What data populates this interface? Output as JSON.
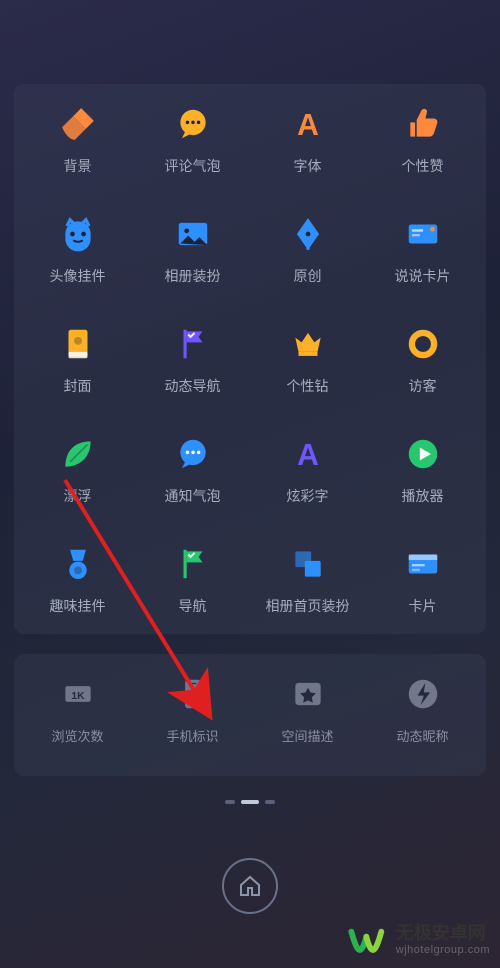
{
  "main": {
    "rows": [
      [
        {
          "name": "background",
          "label": "背景",
          "icon": "broom",
          "color": "#ff8a3d"
        },
        {
          "name": "comment-bubble",
          "label": "评论气泡",
          "icon": "chat",
          "color": "#ffb029"
        },
        {
          "name": "font",
          "label": "字体",
          "icon": "letterA",
          "color": "#ff8a3d"
        },
        {
          "name": "like",
          "label": "个性赞",
          "icon": "thumb",
          "color": "#ff8a3d"
        }
      ],
      [
        {
          "name": "avatar-pendant",
          "label": "头像挂件",
          "icon": "monster",
          "color": "#2e90ff"
        },
        {
          "name": "album-decor",
          "label": "相册装扮",
          "icon": "image",
          "color": "#2e90ff"
        },
        {
          "name": "original",
          "label": "原创",
          "icon": "pen",
          "color": "#2e90ff"
        },
        {
          "name": "talk-card",
          "label": "说说卡片",
          "icon": "card",
          "color": "#2e90ff"
        }
      ],
      [
        {
          "name": "cover",
          "label": "封面",
          "icon": "book",
          "color": "#ffb029"
        },
        {
          "name": "dynamic-nav",
          "label": "动态导航",
          "icon": "flag",
          "color": "#6f56ff"
        },
        {
          "name": "diamond",
          "label": "个性钻",
          "icon": "crown",
          "color": "#ffb029"
        },
        {
          "name": "visitor",
          "label": "访客",
          "icon": "circleO",
          "color": "#ffb029"
        }
      ],
      [
        {
          "name": "float",
          "label": "漂浮",
          "icon": "leaf",
          "color": "#28c76f"
        },
        {
          "name": "notify-bubble",
          "label": "通知气泡",
          "icon": "chatdots",
          "color": "#2e90ff"
        },
        {
          "name": "color-font",
          "label": "炫彩字",
          "icon": "letterA",
          "color": "#6f56ff"
        },
        {
          "name": "player",
          "label": "播放器",
          "icon": "play",
          "color": "#28c76f"
        }
      ],
      [
        {
          "name": "fun-pendant",
          "label": "趣味挂件",
          "icon": "medal",
          "color": "#2e90ff"
        },
        {
          "name": "nav",
          "label": "导航",
          "icon": "flag",
          "color": "#28c76f"
        },
        {
          "name": "album-home-decor",
          "label": "相册首页装扮",
          "icon": "windows",
          "color": "#2e90ff"
        },
        {
          "name": "card",
          "label": "卡片",
          "icon": "idcard",
          "color": "#2e90ff"
        }
      ]
    ]
  },
  "sub": {
    "items": [
      {
        "name": "view-count",
        "label": "浏览次数",
        "icon": "counter"
      },
      {
        "name": "phone-id",
        "label": "手机标识",
        "icon": "phone"
      },
      {
        "name": "space-desc",
        "label": "空间描述",
        "icon": "starbox"
      },
      {
        "name": "dynamic-nickname",
        "label": "动态昵称",
        "icon": "bolt"
      }
    ]
  },
  "dots": {
    "count": 3,
    "active": 1
  },
  "watermark": {
    "cn": "无极安卓网",
    "site": "wjhotelgroup.com"
  }
}
